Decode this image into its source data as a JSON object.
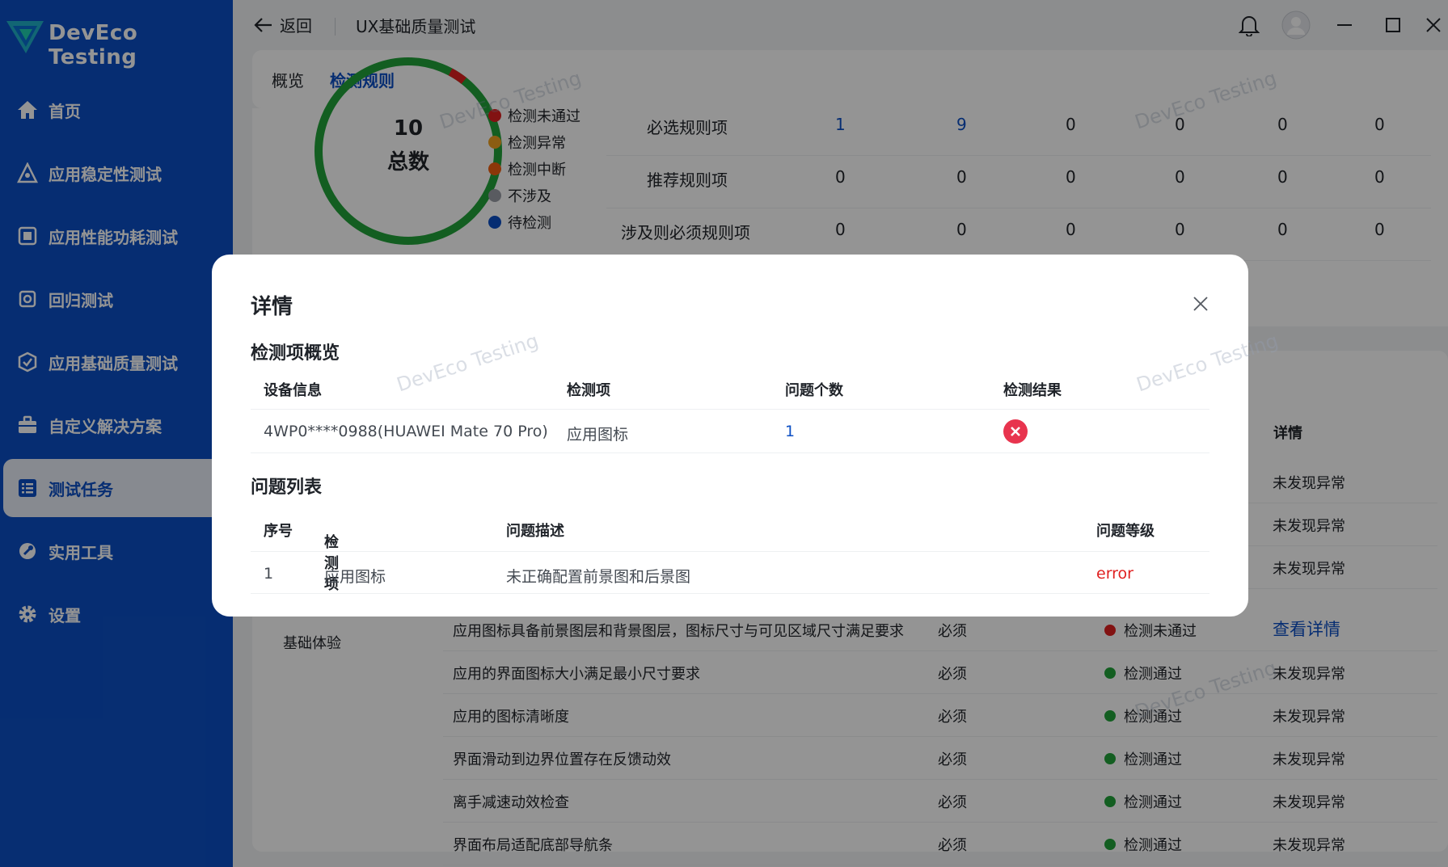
{
  "app": {
    "name": "DevEco Testing",
    "back_label": "返回",
    "page_title": "UX基础质量测试"
  },
  "sidebar": {
    "items": [
      {
        "label": "首页",
        "icon": "home-icon"
      },
      {
        "label": "应用稳定性测试",
        "icon": "stability-icon"
      },
      {
        "label": "应用性能功耗测试",
        "icon": "performance-icon"
      },
      {
        "label": "回归测试",
        "icon": "regression-icon"
      },
      {
        "label": "应用基础质量测试",
        "icon": "quality-icon"
      },
      {
        "label": "自定义解决方案",
        "icon": "toolbox-icon"
      },
      {
        "label": "测试任务",
        "icon": "task-list-icon",
        "active": true
      },
      {
        "label": "实用工具",
        "icon": "tools-icon"
      },
      {
        "label": "设置",
        "icon": "gear-icon"
      }
    ]
  },
  "tabs": {
    "overview": "概览",
    "rules": "检测规则"
  },
  "summary": {
    "total_number": "10",
    "total_label": "总数",
    "legend": [
      {
        "label": "检测未通过",
        "color": "#e02020"
      },
      {
        "label": "检测异常",
        "color": "#f0a020"
      },
      {
        "label": "检测中断",
        "color": "#f06010"
      },
      {
        "label": "不涉及",
        "color": "#9a9ea6"
      },
      {
        "label": "待检测",
        "color": "#0c4fc4"
      }
    ],
    "rules_rows": [
      {
        "name": "必选规则项",
        "values": [
          "1",
          "9",
          "0",
          "0",
          "0",
          "0"
        ]
      },
      {
        "name": "推荐规则项",
        "values": [
          "0",
          "0",
          "0",
          "0",
          "0",
          "0"
        ]
      },
      {
        "name": "涉及则必须规则项",
        "values": [
          "0",
          "0",
          "0",
          "0",
          "0",
          "0"
        ]
      }
    ]
  },
  "rule_list": {
    "detail_header": "详情",
    "group_label": "基础体验",
    "rows": [
      {
        "desc": "",
        "req": "",
        "status": "",
        "detail": "未发现异常"
      },
      {
        "desc": "",
        "req": "",
        "status": "",
        "detail": "未发现异常"
      },
      {
        "desc": "",
        "req": "",
        "status": "",
        "detail": "未发现异常"
      },
      {
        "desc": "应用图标具备前景图层和背景图层，图标尺寸与可见区域尺寸满足要求",
        "req": "必须",
        "status": "检测未通过",
        "detail": "查看详情"
      },
      {
        "desc": "应用的界面图标大小满足最小尺寸要求",
        "req": "必须",
        "status": "检测通过",
        "detail": "未发现异常"
      },
      {
        "desc": "应用的图标清晰度",
        "req": "必须",
        "status": "检测通过",
        "detail": "未发现异常"
      },
      {
        "desc": "界面滑动到边界位置存在反馈动效",
        "req": "必须",
        "status": "检测通过",
        "detail": "未发现异常"
      },
      {
        "desc": "离手减速动效检查",
        "req": "必须",
        "status": "检测通过",
        "detail": "未发现异常"
      },
      {
        "desc": "界面布局适配底部导航条",
        "req": "必须",
        "status": "检测通过",
        "detail": "未发现异常"
      }
    ]
  },
  "watermark": "DevEco Testing",
  "modal": {
    "title": "详情",
    "overview_section": "检测项概览",
    "overview_headers": {
      "device": "设备信息",
      "item": "检测项",
      "count": "问题个数",
      "result": "检测结果"
    },
    "overview_row": {
      "device": "4WP0****0988(HUAWEI Mate 70 Pro)",
      "item": "应用图标",
      "count": "1",
      "result_icon": "fail-icon"
    },
    "issues_section": "问题列表",
    "issues_headers": {
      "index": "序号",
      "item": "检测项",
      "desc": "问题描述",
      "level": "问题等级"
    },
    "issues": [
      {
        "index": "1",
        "item": "应用图标",
        "desc": "未正确配置前景图和后景图",
        "level": "error"
      }
    ]
  },
  "colors": {
    "primary": "#0c4fc4",
    "pass": "#22a33a",
    "fail": "#e02020",
    "error_text": "#e02020"
  }
}
